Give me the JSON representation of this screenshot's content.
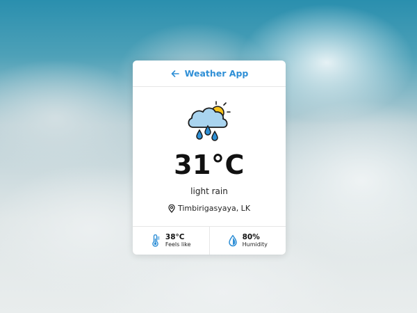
{
  "header": {
    "title": "Weather App",
    "back_icon": "arrow-left-icon"
  },
  "current": {
    "icon": "cloud-sun-rain-icon",
    "temperature": "31°C",
    "description": "light rain",
    "location_icon": "map-pin-icon",
    "location": "Timbirigasyaya, LK"
  },
  "details": {
    "feels_like": {
      "icon": "thermometer-icon",
      "value": "38°C",
      "label": "Feels like"
    },
    "humidity": {
      "icon": "water-drop-icon",
      "value": "80%",
      "label": "Humidity"
    }
  },
  "colors": {
    "accent": "#2f8fd6",
    "cloud_fill": "#a9d4ef",
    "sun": "#f7c21a"
  }
}
